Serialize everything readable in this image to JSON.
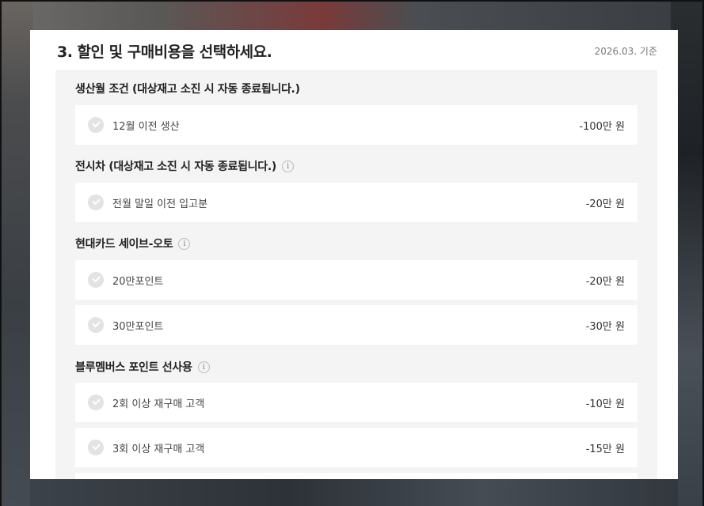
{
  "header": {
    "title": "3. 할인 및 구매비용을 선택하세요.",
    "date": "2026.03. 기준"
  },
  "sections": [
    {
      "title": "생산월 조건 (대상재고 소진 시 자동 종료됩니다.)",
      "has_info": false,
      "options": [
        {
          "label": "12월 이전 생산",
          "price": "-100만 원"
        }
      ]
    },
    {
      "title": "전시차 (대상재고 소진 시 자동 종료됩니다.)",
      "has_info": true,
      "options": [
        {
          "label": "전월 말일 이전 입고분",
          "price": "-20만 원"
        }
      ]
    },
    {
      "title": "현대카드 세이브-오토",
      "has_info": true,
      "options": [
        {
          "label": "20만포인트",
          "price": "-20만 원"
        },
        {
          "label": "30만포인트",
          "price": "-30만 원"
        }
      ]
    },
    {
      "title": "블루멤버스 포인트 선사용",
      "has_info": true,
      "options": [
        {
          "label": "2회 이상 재구매 고객",
          "price": "-10만 원"
        },
        {
          "label": "3회 이상 재구매 고객",
          "price": "-15만 원"
        }
      ]
    }
  ],
  "icons": {
    "info": "i",
    "check": "check-icon"
  },
  "colors": {
    "panel_bg": "#ffffff",
    "section_bg": "#f4f4f4",
    "check_bg": "#e3e3e3"
  }
}
